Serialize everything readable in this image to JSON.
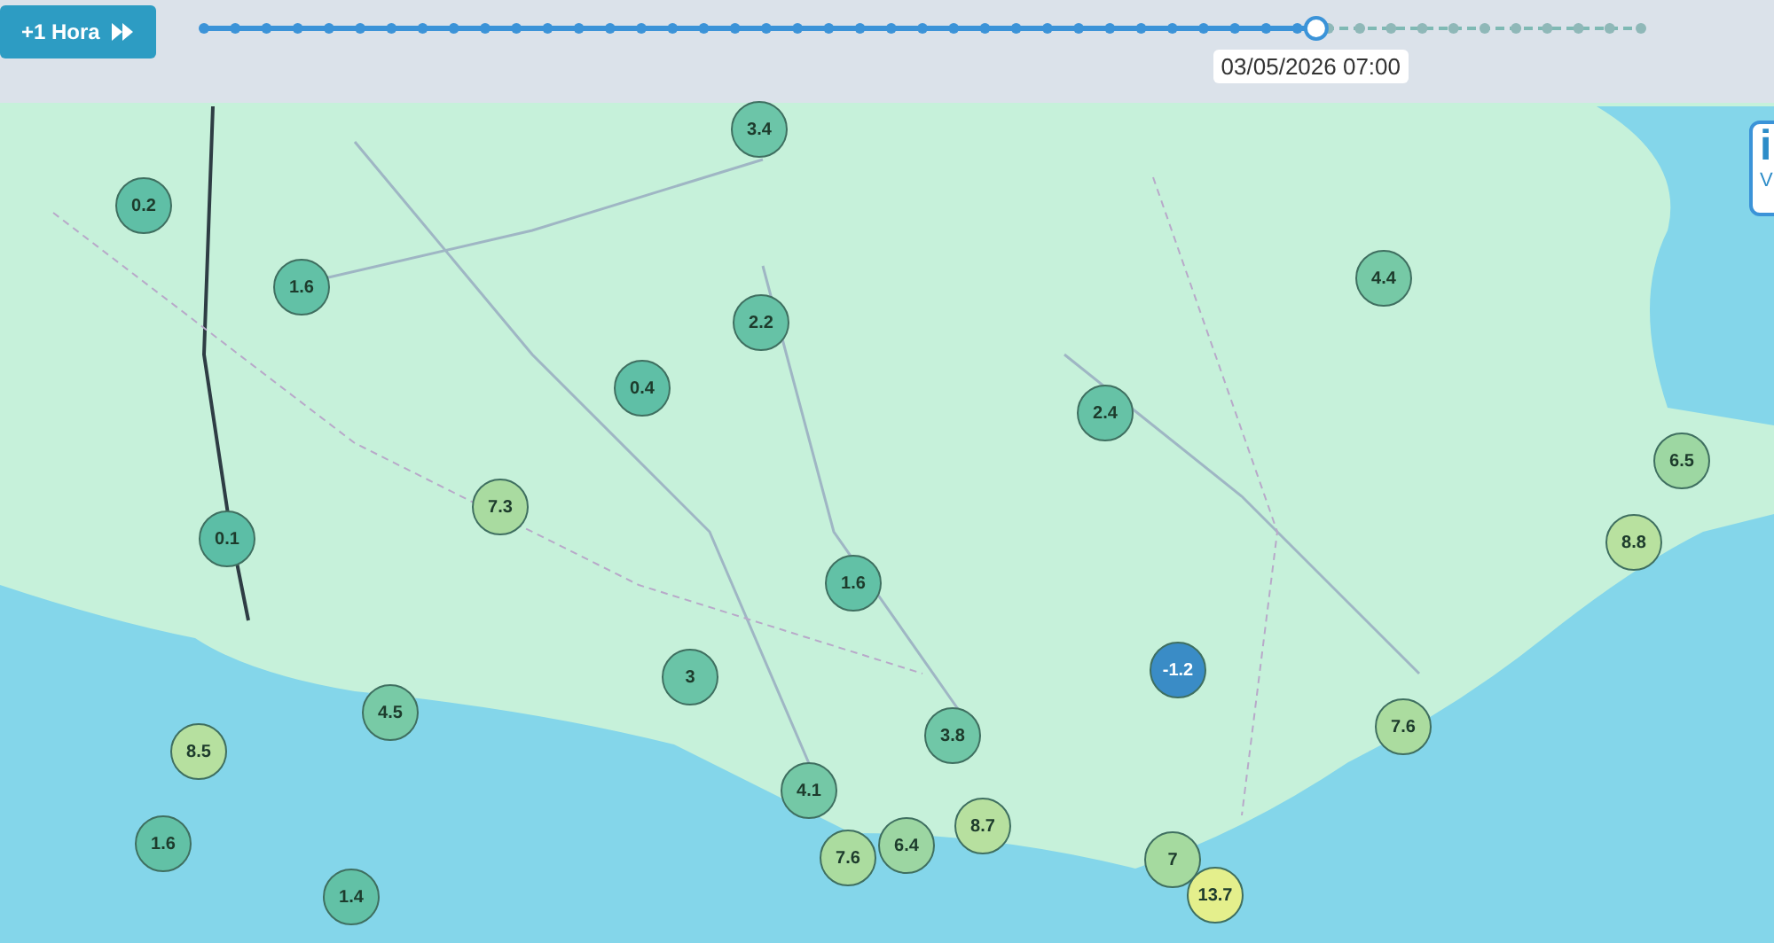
{
  "toolbar": {
    "next_button": "+1 Hora"
  },
  "timeline": {
    "level": 0.774,
    "time_label": "03/05/2026 07:00"
  },
  "side_widget": {
    "big_letter": "i",
    "small_letter": "V"
  },
  "markers": [
    {
      "value": "3.4",
      "color": "#6cc5a8"
    },
    {
      "value": "0.2",
      "color": "#5fbfa6"
    },
    {
      "value": "1.6",
      "color": "#62c1a6"
    },
    {
      "value": "2.2",
      "color": "#66c2a6"
    },
    {
      "value": "0.4",
      "color": "#5fbfa6"
    },
    {
      "value": "4.4",
      "color": "#76c9a6"
    },
    {
      "value": "2.4",
      "color": "#66c2a6"
    },
    {
      "value": "7.3",
      "color": "#a9dba0"
    },
    {
      "value": "6.5",
      "color": "#9dd7a2"
    },
    {
      "value": "0.1",
      "color": "#5cbea6"
    },
    {
      "value": "8.8",
      "color": "#b8e19f"
    },
    {
      "value": "1.6",
      "color": "#62c1a6"
    },
    {
      "value": "-1.2",
      "color": "#3a8cc6"
    },
    {
      "value": "3",
      "color": "#6ac4a7"
    },
    {
      "value": "4.5",
      "color": "#78caa6"
    },
    {
      "value": "3.8",
      "color": "#70c7a7"
    },
    {
      "value": "7.6",
      "color": "#abdc9f"
    },
    {
      "value": "8.5",
      "color": "#b6e09f"
    },
    {
      "value": "4.1",
      "color": "#74c8a6"
    },
    {
      "value": "1.6",
      "color": "#62c1a6"
    },
    {
      "value": "8.7",
      "color": "#b7e09f"
    },
    {
      "value": "6.4",
      "color": "#9cd6a2"
    },
    {
      "value": "7.6",
      "color": "#abdc9f"
    },
    {
      "value": "7",
      "color": "#a5da9f"
    },
    {
      "value": "1.4",
      "color": "#62c1a6"
    },
    {
      "value": "13.7",
      "color": "#e4ef8c"
    }
  ]
}
